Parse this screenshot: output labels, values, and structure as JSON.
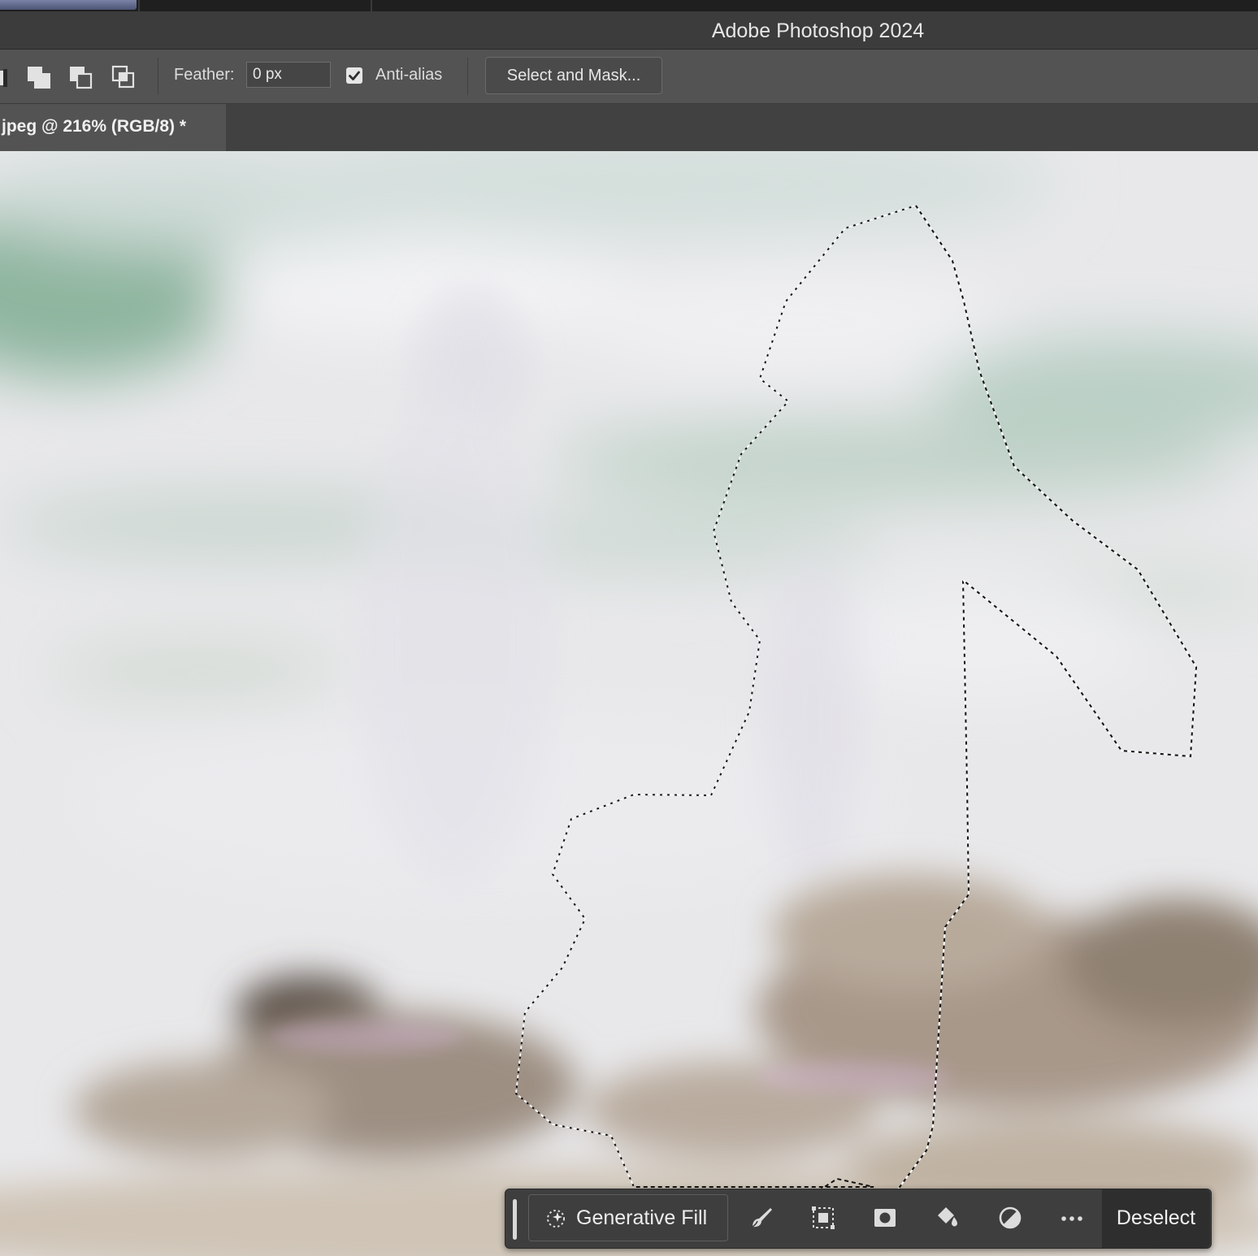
{
  "window": {
    "title": "Adobe Photoshop 2024"
  },
  "options_bar": {
    "icons": [
      "new-selection-icon",
      "add-to-selection-icon",
      "subtract-from-selection-icon",
      "intersect-selection-icon"
    ],
    "feather_label": "Feather:",
    "feather_value": "0 px",
    "anti_alias_label": "Anti-alias",
    "anti_alias_checked": true,
    "select_and_mask_label": "Select and Mask..."
  },
  "document_tab": {
    "label": "jpeg @ 216% (RGB/8) *"
  },
  "contextual_task_bar": {
    "generative_fill_label": "Generative Fill",
    "icons": [
      "brush-modify-icon",
      "transform-selection-icon",
      "mask-icon",
      "fill-bucket-icon",
      "adjustment-icon",
      "more-options-icon"
    ],
    "deselect_label": "Deselect"
  },
  "colors": {
    "options_bar_bg": "#535353",
    "title_bar_bg": "#3c3c3c",
    "task_bar_bg": "#3e3e3e"
  }
}
